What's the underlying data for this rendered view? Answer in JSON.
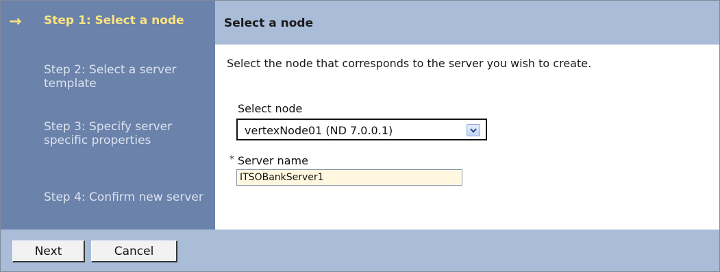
{
  "wizard": {
    "current_indicator": "→",
    "steps": [
      {
        "label": "Step 1: Select a node"
      },
      {
        "label": "Step 2: Select a server template"
      },
      {
        "label": "Step 3: Specify server specific properties"
      },
      {
        "label": "Step 4: Confirm new server"
      }
    ]
  },
  "panel": {
    "title": "Select a node",
    "description": "Select the node that corresponds to the server you wish to create.",
    "select_node": {
      "label": "Select node",
      "value": "vertexNode01 (ND 7.0.0.1)"
    },
    "server_name": {
      "required_marker": "*",
      "label": "Server name",
      "value": "ITSOBankServer1"
    }
  },
  "footer": {
    "next_label": "Next",
    "cancel_label": "Cancel"
  },
  "colors": {
    "sidebar": "#6b82aa",
    "header": "#a9bcd8",
    "current_step": "#ffe680",
    "input_bg": "#fff7df"
  }
}
